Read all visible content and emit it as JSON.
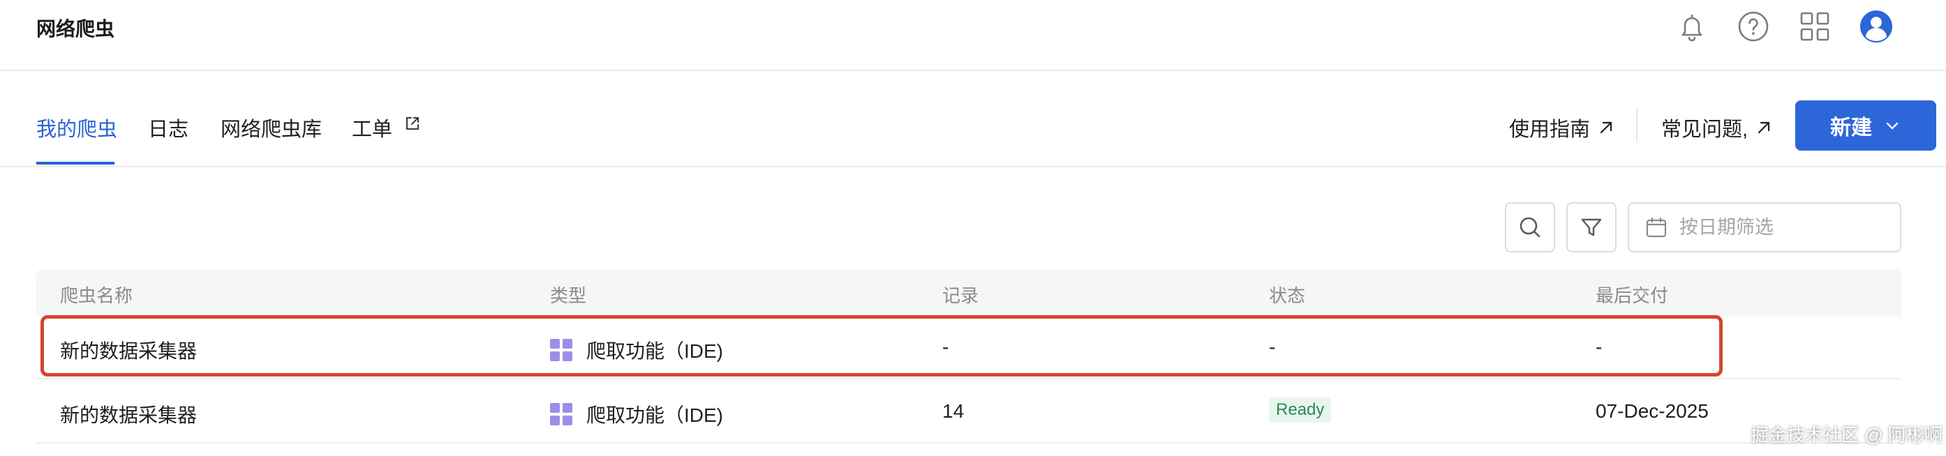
{
  "app": {
    "title": "网络爬虫"
  },
  "topbar": {
    "icons": [
      "bell-icon",
      "help-icon",
      "apps-grid-icon",
      "user-avatar-icon"
    ]
  },
  "tabs": [
    {
      "label": "我的爬虫",
      "active": true
    },
    {
      "label": "日志",
      "active": false
    },
    {
      "label": "网络爬虫库",
      "active": false
    },
    {
      "label": "工单",
      "active": false,
      "external": true
    }
  ],
  "header_links": {
    "guide": "使用指南",
    "faq": "常见问题,"
  },
  "new_button": {
    "label": "新建"
  },
  "toolbar": {
    "date_placeholder": "按日期筛选"
  },
  "table": {
    "columns": [
      "爬虫名称",
      "类型",
      "记录",
      "状态",
      "最后交付"
    ],
    "rows": [
      {
        "name": "新的数据采集器",
        "type": "爬取功能（IDE)",
        "records": "-",
        "status": "-",
        "last_delivery": "-"
      },
      {
        "name": "新的数据采集器",
        "type": "爬取功能（IDE)",
        "records": "14",
        "status": "Ready",
        "last_delivery": "07-Dec-2025"
      }
    ]
  },
  "colors": {
    "accent": "#2c66d8",
    "highlight": "#d6452e",
    "ready_badge_bg": "#e8f5ee",
    "ready_badge_text": "#2e8a55",
    "type_icon": "#9a8ee6"
  },
  "watermark": "掘金技术社区 @ 阿彬啊"
}
